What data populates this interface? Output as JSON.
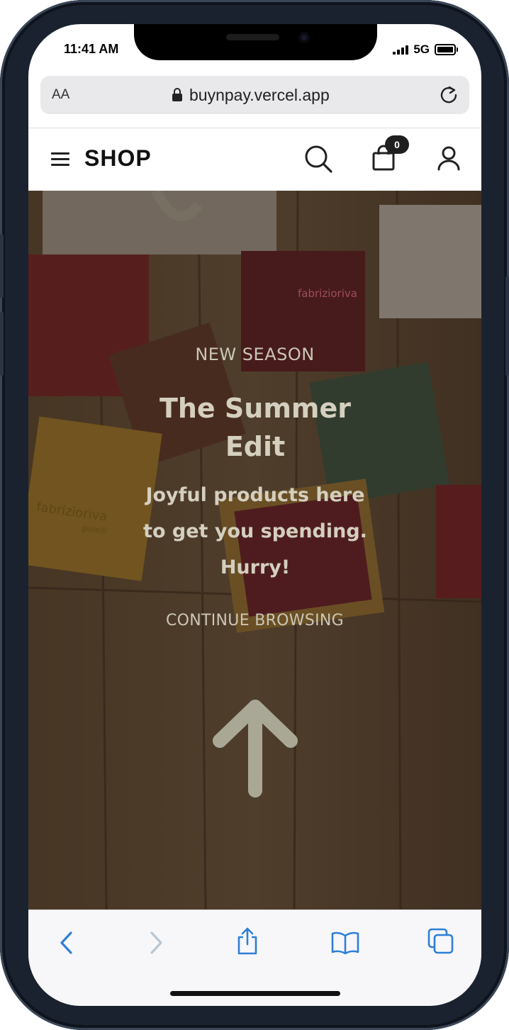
{
  "status_bar": {
    "time": "11:41 AM",
    "network": "5G"
  },
  "browser": {
    "text_size_label": "AA",
    "url": "buynpay.vercel.app"
  },
  "header": {
    "logo": "SHOP",
    "cart_count": "0"
  },
  "hero": {
    "kicker": "NEW SEASON",
    "title": "The Summer Edit",
    "subtitle": "Joyful products here to get you spending. Hurry!",
    "cta": "CONTINUE BROWSING",
    "brand_mark": "fabrizioriva",
    "brand_sub": "gioielli"
  },
  "colors": {
    "accent_blue": "#2f7fd6",
    "hero_text": "#cbc6b6",
    "hero_overlay": "#2a1f16"
  },
  "icons": {
    "menu": "hamburger-icon",
    "search": "search-icon",
    "cart": "shopping-bag-icon",
    "user": "user-icon",
    "reload": "reload-icon",
    "back": "chevron-left-icon",
    "forward": "chevron-right-icon",
    "share": "share-icon",
    "bookmarks": "book-icon",
    "tabs": "tabs-icon"
  }
}
